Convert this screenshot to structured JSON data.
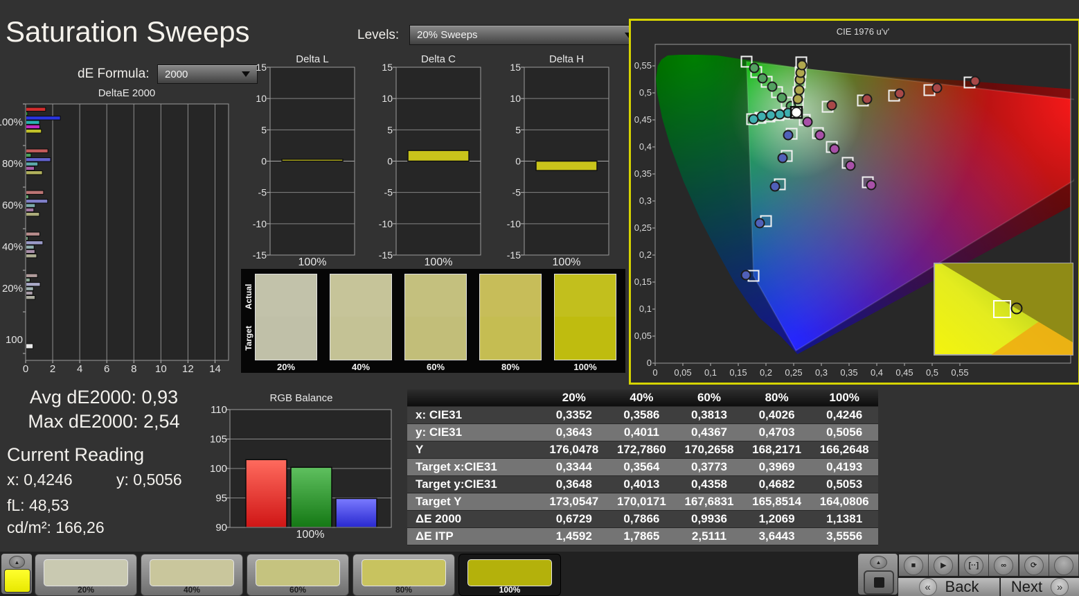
{
  "app": {
    "title": "Saturation Sweeps"
  },
  "controls": {
    "de_formula": {
      "label": "dE Formula:",
      "value": "2000"
    },
    "levels": {
      "label": "Levels:",
      "value": "20% Sweeps"
    }
  },
  "stats": {
    "avg_label": "Avg dE2000:",
    "avg_value": "0,93",
    "max_label": "Max dE2000:",
    "max_value": "2,54"
  },
  "current_reading": {
    "title": "Current Reading",
    "x_label": "x:",
    "x_value": "0,4246",
    "y_label": "y:",
    "y_value": "0,5056",
    "fl_label": "fL:",
    "fl_value": "48,53",
    "cd_label": "cd/m²:",
    "cd_value": "166,26"
  },
  "swatch_panel": {
    "row_labels": [
      "Actual",
      "Target"
    ],
    "items": [
      {
        "label": "20%",
        "actual": "#c2c2aa",
        "target": "#c0c0a8"
      },
      {
        "label": "40%",
        "actual": "#c6c499",
        "target": "#c4c295"
      },
      {
        "label": "60%",
        "actual": "#c4c07e",
        "target": "#c2be79"
      },
      {
        "label": "80%",
        "actual": "#c7bd59",
        "target": "#c5bd52"
      },
      {
        "label": "100%",
        "actual": "#c2bf1d",
        "target": "#bfbc0f"
      }
    ]
  },
  "table": {
    "columns": [
      "",
      "20%",
      "40%",
      "60%",
      "80%",
      "100%"
    ],
    "rows": [
      {
        "label": "x: CIE31",
        "values": [
          "0,3352",
          "0,3586",
          "0,3813",
          "0,4026",
          "0,4246"
        ]
      },
      {
        "label": "y: CIE31",
        "values": [
          "0,3643",
          "0,4011",
          "0,4367",
          "0,4703",
          "0,5056"
        ]
      },
      {
        "label": "Y",
        "values": [
          "176,0478",
          "172,7860",
          "170,2658",
          "168,2171",
          "166,2648"
        ]
      },
      {
        "label": "Target x:CIE31",
        "values": [
          "0,3344",
          "0,3564",
          "0,3773",
          "0,3969",
          "0,4193"
        ]
      },
      {
        "label": "Target y:CIE31",
        "values": [
          "0,3648",
          "0,4013",
          "0,4358",
          "0,4682",
          "0,5053"
        ]
      },
      {
        "label": "Target Y",
        "values": [
          "173,0547",
          "170,0171",
          "167,6831",
          "165,8514",
          "164,0806"
        ]
      },
      {
        "label": "ΔE 2000",
        "values": [
          "0,6729",
          "0,7866",
          "0,9936",
          "1,2069",
          "1,1381"
        ]
      },
      {
        "label": "ΔE ITP",
        "values": [
          "1,4592",
          "1,7865",
          "2,5111",
          "3,6443",
          "3,5556"
        ]
      }
    ]
  },
  "toolbar": {
    "current_patch_color": "#ffff2e",
    "up_arrow_icon": "▲",
    "level_buttons": [
      {
        "label": "20%",
        "color": "#c9c9b1",
        "selected": false
      },
      {
        "label": "40%",
        "color": "#c9c69c",
        "selected": false
      },
      {
        "label": "60%",
        "color": "#c5c37f",
        "selected": false
      },
      {
        "label": "80%",
        "color": "#c8c35f",
        "selected": false
      },
      {
        "label": "100%",
        "color": "#b4b10b",
        "selected": true
      }
    ],
    "media_buttons": [
      "stop",
      "play",
      "pattern",
      "loop",
      "refresh",
      "blank"
    ],
    "back_label": "Back",
    "next_label": "Next",
    "back_chevron": "«",
    "next_chevron": "»"
  },
  "chart_data": [
    {
      "id": "deltae2000",
      "type": "bar",
      "orientation": "horizontal",
      "title": "DeltaE 2000",
      "xlim": [
        0,
        15
      ],
      "xticks": [
        0,
        2,
        4,
        6,
        8,
        10,
        12,
        14
      ],
      "bar_order": [
        "red",
        "green",
        "blue",
        "cyan",
        "magenta",
        "yellow"
      ],
      "groups": [
        {
          "label": "100%",
          "values": [
            1.45,
            0.12,
            2.54,
            1.0,
            1.02,
            1.14
          ],
          "colors": [
            "#d32d2d",
            "#29a438",
            "#2a35dd",
            "#2ab2b2",
            "#c22ac2",
            "#c2c22a"
          ]
        },
        {
          "label": "80%",
          "values": [
            1.62,
            0.38,
            1.82,
            0.88,
            0.62,
            1.21
          ],
          "colors": [
            "#c45c5c",
            "#49a159",
            "#6363cf",
            "#5daaaa",
            "#a75da7",
            "#b0b05c"
          ]
        },
        {
          "label": "60%",
          "values": [
            1.3,
            0.2,
            1.6,
            0.68,
            0.58,
            0.99
          ],
          "colors": [
            "#bc7575",
            "#62a56f",
            "#8181ca",
            "#7caaaa",
            "#a377a3",
            "#acac7b"
          ]
        },
        {
          "label": "40%",
          "values": [
            1.02,
            0.15,
            1.25,
            0.6,
            0.66,
            0.79
          ],
          "colors": [
            "#b88c8c",
            "#7ba987",
            "#9a9ac8",
            "#92b0b0",
            "#a88ea8",
            "#acac91"
          ]
        },
        {
          "label": "20%",
          "values": [
            0.85,
            0.3,
            1.05,
            0.55,
            0.5,
            0.67
          ],
          "colors": [
            "#b19c9c",
            "#8eab96",
            "#aaaac8",
            "#a1b3b3",
            "#a89da8",
            "#abab9f"
          ]
        },
        {
          "label": "100",
          "values": [
            0.52
          ],
          "colors": [
            "#e9e9e9"
          ]
        }
      ]
    },
    {
      "id": "delta_l",
      "type": "bar",
      "title": "Delta L",
      "categories": [
        "100%"
      ],
      "values": [
        0.3
      ],
      "ylim": [
        -15,
        15
      ],
      "yticks": [
        15,
        10,
        5,
        0,
        -5,
        -10,
        -15
      ],
      "bar_color": "#c9c41b"
    },
    {
      "id": "delta_c",
      "type": "bar",
      "title": "Delta C",
      "categories": [
        "100%"
      ],
      "values": [
        1.7
      ],
      "ylim": [
        -15,
        15
      ],
      "yticks": [
        15,
        10,
        5,
        0,
        -5,
        -10,
        -15
      ],
      "bar_color": "#c9c41b"
    },
    {
      "id": "delta_h",
      "type": "bar",
      "title": "Delta H",
      "categories": [
        "100%"
      ],
      "values": [
        -1.5
      ],
      "ylim": [
        -15,
        15
      ],
      "yticks": [
        15,
        10,
        5,
        0,
        -5,
        -10,
        -15
      ],
      "bar_color": "#c9c41b"
    },
    {
      "id": "rgb_balance",
      "type": "bar",
      "title": "RGB Balance",
      "categories": [
        "Red",
        "Green",
        "Blue"
      ],
      "values": [
        101.5,
        100.2,
        94.9
      ],
      "ylim": [
        90,
        110
      ],
      "yticks": [
        110,
        105,
        100,
        95,
        90
      ],
      "colors": [
        "#e03030",
        "#2e9e3e",
        "#4747e8"
      ],
      "xlabel": "100%"
    },
    {
      "id": "cie",
      "type": "scatter",
      "title": "CIE 1976 u'v'",
      "x_ticks": [
        "0",
        "0,05",
        "0,1",
        "0,15",
        "0,2",
        "0,25",
        "0,3",
        "0,35",
        "0,4",
        "0,45",
        "0,5",
        "0,55"
      ],
      "y_ticks": [
        "0",
        "0,05",
        "0,1",
        "0,15",
        "0,2",
        "0,25",
        "0,3",
        "0,35",
        "0,4",
        "0,45",
        "0,5",
        "0,55"
      ],
      "axis_range_u": [
        0,
        0.75
      ],
      "axis_range_v": [
        0,
        0.605
      ],
      "white_point": {
        "u": 0.255,
        "v": 0.476
      },
      "sweeps": [
        {
          "name": "green",
          "color": "#52a060",
          "targets": [
            [
              0.2375,
              0.4947
            ],
            [
              0.22,
              0.5145
            ],
            [
              0.2013,
              0.5342
            ],
            [
              0.1825,
              0.5526
            ],
            [
              0.165,
              0.5724
            ]
          ],
          "measured": [
            [
              0.245,
              0.4882
            ],
            [
              0.2288,
              0.5039
            ],
            [
              0.2113,
              0.525
            ],
            [
              0.1938,
              0.5408
            ],
            [
              0.1788,
              0.5605
            ]
          ]
        },
        {
          "name": "yellow",
          "color": "#b0a84e",
          "targets": [
            [
              0.2575,
              0.4947
            ],
            [
              0.2588,
              0.5145
            ],
            [
              0.2613,
              0.5329
            ],
            [
              0.2625,
              0.5526
            ],
            [
              0.2638,
              0.5711
            ]
          ],
          "measured": [
            [
              0.2575,
              0.5013
            ],
            [
              0.26,
              0.5184
            ],
            [
              0.2613,
              0.5382
            ],
            [
              0.2625,
              0.5513
            ],
            [
              0.265,
              0.5658
            ]
          ]
        },
        {
          "name": "cyan",
          "color": "#3fb0b0",
          "targets": [
            [
              0.2388,
              0.4737
            ],
            [
              0.2225,
              0.4711
            ],
            [
              0.2063,
              0.4684
            ],
            [
              0.19,
              0.4658
            ],
            [
              0.175,
              0.4632
            ]
          ],
          "measured": [
            [
              0.24,
              0.475
            ],
            [
              0.225,
              0.4724
            ],
            [
              0.2088,
              0.4711
            ],
            [
              0.1925,
              0.4684
            ],
            [
              0.1775,
              0.4632
            ]
          ]
        },
        {
          "name": "red",
          "color": "#a84848",
          "targets": [
            [
              0.3113,
              0.4868
            ],
            [
              0.375,
              0.4987
            ],
            [
              0.4313,
              0.5079
            ],
            [
              0.495,
              0.5184
            ],
            [
              0.5675,
              0.5329
            ]
          ],
          "measured": [
            [
              0.3188,
              0.4895
            ],
            [
              0.3825,
              0.5013
            ],
            [
              0.4413,
              0.5118
            ],
            [
              0.5088,
              0.5224
            ],
            [
              0.5775,
              0.5355
            ]
          ]
        },
        {
          "name": "magenta",
          "color": "#a850a8",
          "targets": [
            [
              0.27,
              0.4618
            ],
            [
              0.2938,
              0.4368
            ],
            [
              0.3188,
              0.4105
            ],
            [
              0.3475,
              0.3803
            ],
            [
              0.3838,
              0.3434
            ]
          ],
          "measured": [
            [
              0.275,
              0.4579
            ],
            [
              0.2975,
              0.4329
            ],
            [
              0.3238,
              0.4066
            ],
            [
              0.3525,
              0.375
            ],
            [
              0.39,
              0.3382
            ]
          ]
        },
        {
          "name": "blue",
          "color": "#5060b8",
          "targets": [
            [
              0.2463,
              0.4355
            ],
            [
              0.2375,
              0.3934
            ],
            [
              0.225,
              0.3395
            ],
            [
              0.2,
              0.2697
            ],
            [
              0.1775,
              0.1658
            ]
          ],
          "measured": [
            [
              0.24,
              0.4329
            ],
            [
              0.23,
              0.3895
            ],
            [
              0.2163,
              0.3355
            ],
            [
              0.1888,
              0.2658
            ],
            [
              0.1638,
              0.1671
            ]
          ]
        }
      ],
      "inset": {
        "target_marker": "square",
        "measured_marker": "circle"
      }
    }
  ]
}
